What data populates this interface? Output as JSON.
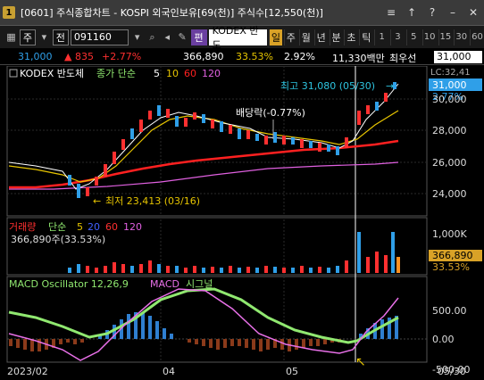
{
  "window": {
    "icon_label": "1",
    "title": "[0601] 주식종합차트 - KOSPI 외국인보유[69(천)] 주식수[12,550(천)]",
    "controls": [
      "≡",
      "↑",
      "?",
      "–",
      "✕"
    ]
  },
  "toolbar": {
    "market": "주",
    "prev_label": "전",
    "code": "091160",
    "market_badge": "편",
    "name": "KODEX 반도",
    "periods": [
      "일",
      "주",
      "월",
      "년",
      "분",
      "초",
      "틱"
    ],
    "active_period": "일",
    "intervals": [
      "1",
      "3",
      "5",
      "10",
      "15",
      "30",
      "60"
    ]
  },
  "infobar": {
    "price": "31,000",
    "change": "835",
    "change_pct": "+2.77%",
    "volume": "366,890",
    "vol_ratio": "33.53%",
    "extra_pct": "2.92%",
    "amount": "11,330백만",
    "priority": "최우선"
  },
  "price_panel": {
    "legend_name": "KODEX 반도체",
    "legend_ma": "종가 단순",
    "ma_periods": [
      "5",
      "10",
      "60",
      "120"
    ],
    "high_label": "최고 31,080 (05/30)",
    "low_label": "최저 23,413 (03/16)",
    "event_label": "배당락(-0.77%)",
    "y_ticks": [
      "30,000",
      "28,000",
      "26,000",
      "24,000"
    ],
    "current_price": "31,000",
    "current_pct": "2.77%",
    "lc_label": "LC:32,41"
  },
  "volume_panel": {
    "legend_name": "거래량",
    "legend_ma": "단순",
    "ma_periods": [
      "5",
      "20",
      "60",
      "120"
    ],
    "current_label": "366,890주(33.53%)",
    "y_tick": "1,000K",
    "current_value": "366,890",
    "current_pct": "33.53%"
  },
  "macd_panel": {
    "legend": "MACD Oscillator 12,26,9",
    "macd_label": "MACD",
    "signal_label": "시그널",
    "y_ticks": [
      "500.00",
      "0.00",
      "-500.00"
    ]
  },
  "x_axis": {
    "labels": [
      "2023/02",
      "04",
      "05",
      "05/30"
    ]
  },
  "chart_data": {
    "type": "candlestick",
    "title": "KODEX 반도체",
    "y_range": [
      23000,
      32000
    ],
    "high": 31080,
    "low": 23413,
    "last": 31000,
    "volume_last": 366890,
    "macd_range": [
      -600,
      800
    ]
  },
  "colors": {
    "up": "#ff3030",
    "down": "#2f9fe8",
    "ma5": "#ffffff",
    "ma10": "#e6c400",
    "ma60": "#ff2020",
    "ma120": "#e060e0",
    "macd": "#e870e8",
    "signal": "#90e870",
    "accent": "#d9a227"
  }
}
